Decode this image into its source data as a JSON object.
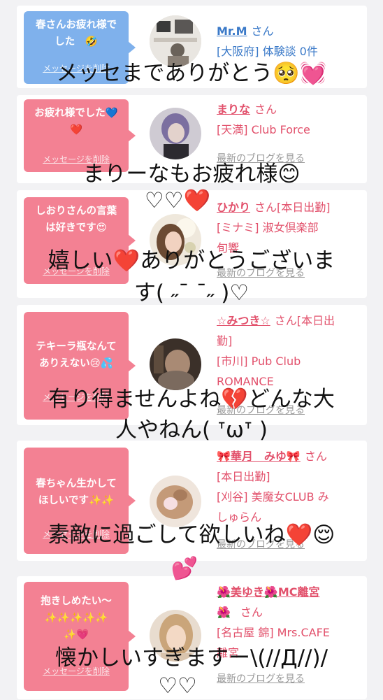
{
  "cards": [
    {
      "bubble_text": [
        "春さんお疲れ様で",
        "した　🤣"
      ],
      "delete_label": "メッセージを削除",
      "name": "Mr.M",
      "honorific": "さん",
      "details": [
        "[大阪府] 体験談 0件"
      ],
      "blog_label": ""
    },
    {
      "bubble_text": [
        "お疲れ様でした💙",
        "❤️"
      ],
      "delete_label": "メッセージを削除",
      "name": "まりな",
      "honorific": "さん",
      "details": [
        "[天満] Club Force"
      ],
      "blog_label": "最新のブログを見る"
    },
    {
      "bubble_text": [
        "しおりさんの言葉",
        "は好きです😍"
      ],
      "delete_label": "メッセージを削除",
      "name": "ひかり",
      "honorific": "さん[本日出勤]",
      "details": [
        "[ミナミ] 淑女倶楽部",
        "旬響"
      ],
      "blog_label": "最新のブログを見る"
    },
    {
      "bubble_text": [
        "テキーラ瓶なんて",
        "ありえない😢💦"
      ],
      "delete_label": "メッセージを削除",
      "name": "☆みつき☆",
      "honorific": "さん[本日出",
      "honorific_line2": "勤]",
      "details": [
        "[市川] Pub Club",
        "ROMANCE"
      ],
      "blog_label": "最新のブログを見る"
    },
    {
      "bubble_text": [
        "春ちゃん生かして",
        "ほしいです✨✨"
      ],
      "delete_label": "メッセージを削除",
      "name": "🎀華月　みゆ🎀",
      "honorific": "さん",
      "details": [
        "[本日出勤]",
        "[刈谷] 美魔女CLUB み",
        "しゅらん"
      ],
      "blog_label": "最新のブログを見る"
    },
    {
      "bubble_text": [
        "抱きしめたい〜",
        "✨✨✨✨✨",
        "✨💗"
      ],
      "delete_label": "メッセージを削除",
      "name": "🌺美ゆき🌺MC離宮",
      "name_line2": "🌺",
      "honorific": "さん",
      "details": [
        "[名古屋 錦] Mrs.CAFE",
        "離宮"
      ],
      "blog_label": "最新のブログを見る"
    }
  ],
  "overlays": [
    "メッセまでありがとう🥺💓",
    "まりーなもお疲れ様😊",
    "♡♡❤️",
    "嬉しい❤️ありがとうございま",
    "す( ˶¯ ¯˶ )♡",
    "有り得ませんよね💔どんな大",
    "人やねん( ᐪωᐪ )",
    "素敵に過ごして欲しいね❤️😌",
    "💕",
    "懐かしいすぎますー\\(//Д//)/",
    "♡♡"
  ]
}
